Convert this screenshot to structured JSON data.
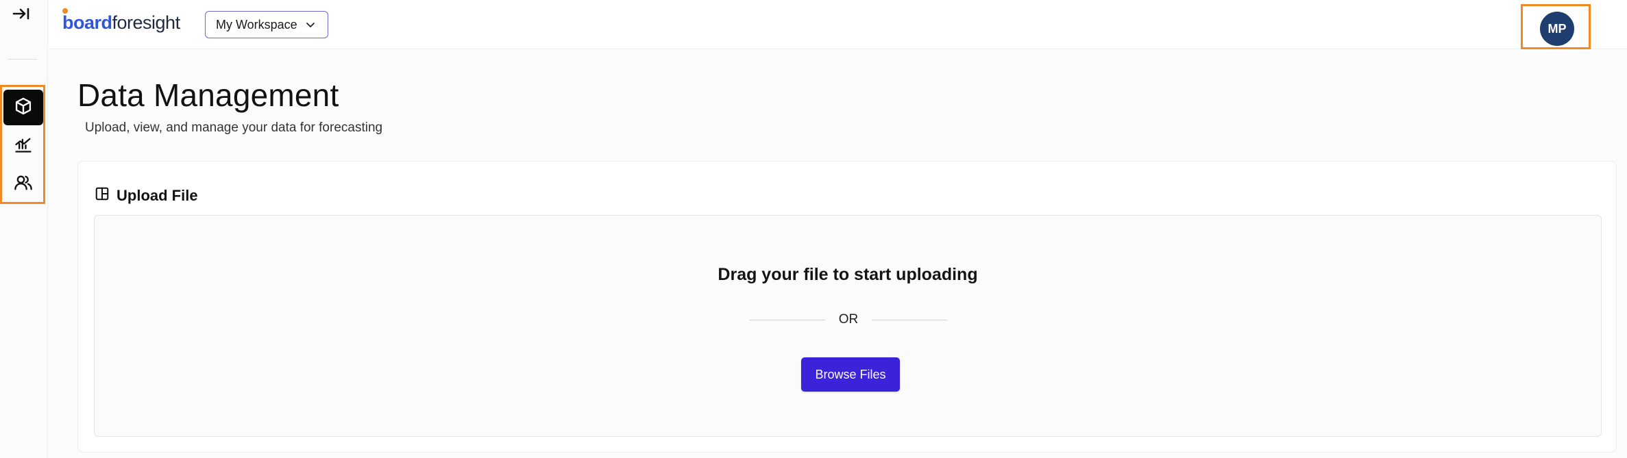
{
  "header": {
    "logo_prefix": "board",
    "logo_suffix": "foresight",
    "workspace_label": "My Workspace",
    "avatar_initials": "MP"
  },
  "sidebar": {
    "collapse_icon": "arrow-right-to-bar-icon",
    "items": [
      {
        "icon": "cube-icon",
        "active": true
      },
      {
        "icon": "chart-icon",
        "active": false
      },
      {
        "icon": "users-icon",
        "active": false
      }
    ]
  },
  "main": {
    "title": "Data Management",
    "subtitle": "Upload, view, and manage your data for forecasting",
    "upload": {
      "title": "Upload File",
      "icon": "layout-panel-icon",
      "drag_text": "Drag your file to start uploading",
      "or_text": "OR",
      "browse_label": "Browse Files"
    }
  },
  "colors": {
    "accent": "#3a23d8",
    "highlight": "#f28a24",
    "avatar_bg": "#1f3d6e",
    "logo_blue": "#2f56d8"
  }
}
